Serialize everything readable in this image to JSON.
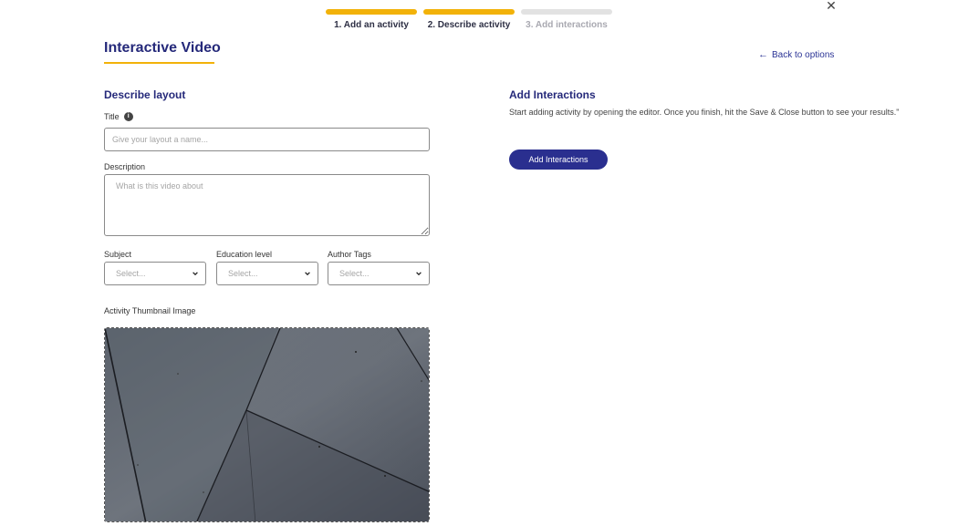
{
  "stepper": {
    "steps": [
      {
        "label": "1. Add an activity",
        "state": "done"
      },
      {
        "label": "2. Describe activity",
        "state": "done"
      },
      {
        "label": "3. Add interactions",
        "state": "pending"
      }
    ]
  },
  "header": {
    "title": "Interactive Video",
    "back_link": "Back to options",
    "close_icon": "close-icon"
  },
  "describe": {
    "section_title": "Describe layout",
    "title_label": "Title",
    "title_placeholder": "Give your layout a name...",
    "description_label": "Description",
    "description_placeholder": "What is this video about",
    "subject_label": "Subject",
    "subject_value": "Select...",
    "education_label": "Education level",
    "education_value": "Select...",
    "tags_label": "Author Tags",
    "tags_value": "Select...",
    "thumbnail_label": "Activity Thumbnail Image"
  },
  "interactions": {
    "section_title": "Add Interactions",
    "description": "Start adding activity by opening the editor. Once you finish, hit the Save & Close button to see your results.\"",
    "button_label": "Add Interactions"
  },
  "colors": {
    "brand": "#25297a",
    "accent": "#f2b209",
    "button": "#2a2f8f"
  }
}
